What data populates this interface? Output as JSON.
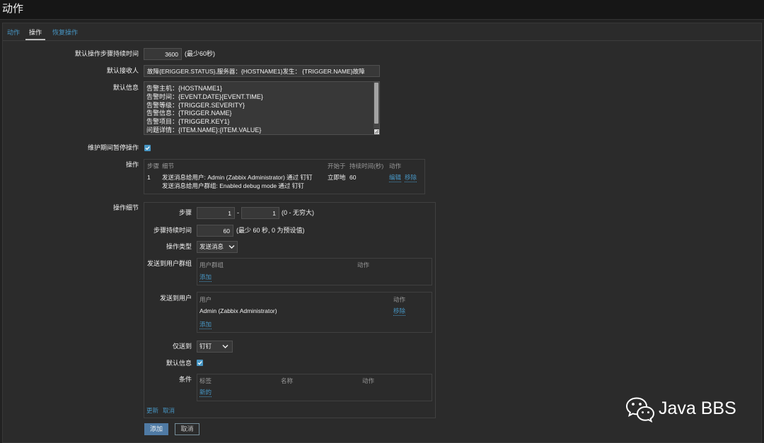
{
  "page": {
    "title": "动作"
  },
  "tabs": [
    {
      "label": "动作",
      "active": false
    },
    {
      "label": "操作",
      "active": true
    },
    {
      "label": "恢复操作",
      "active": false
    }
  ],
  "form": {
    "default_step_duration": {
      "label": "默认操作步骤持续时间",
      "value": "3600",
      "hint": "(最少60秒)"
    },
    "default_subject": {
      "label": "默认接收人",
      "value": "故障{ERIGGER.STATUS},服务器：{HOSTNAME1}发生： {TRIGGER.NAME}故障"
    },
    "default_message": {
      "label": "默认信息",
      "value": "告警主机：{HOSTNAME1}\n告警时间：{EVENT.DATE}{EVENT.TIME}\n告警等级：{TRIGGER.SEVERITY}\n告警信息：{TRIGGER.NAME}\n告警项目：{TRIGGER.KEY1}\n问题详情：{ITEM.NAME}:{ITEM.VALUE}"
    },
    "pause_in_maintenance": {
      "label": "维护期间暂停操作",
      "checked": true,
      "icon": "check-icon"
    },
    "operations": {
      "label": "操作",
      "columns": {
        "step": "步骤",
        "details": "细节",
        "start_in": "开始于",
        "duration": "持续时间(秒)",
        "action": "动作"
      },
      "rows": [
        {
          "step": "1",
          "details": [
            "发送消息给用户: Admin (Zabbix Administrator) 通过 钉钉",
            "发送消息给用户群组: Enabled debug mode 通过 钉钉"
          ],
          "start_in": "立即地",
          "duration": "60",
          "edit": "编辑",
          "remove": "移除"
        }
      ]
    },
    "operation_details": {
      "label": "操作细节",
      "steps": {
        "label": "步骤",
        "from": "1",
        "separator": "-",
        "to": "1",
        "hint": "(0 - 无穷大)"
      },
      "step_duration": {
        "label": "步骤持续时间",
        "value": "60",
        "hint": "(最少 60 秒, 0 为预设值)"
      },
      "operation_type": {
        "label": "操作类型",
        "value": "发送消息",
        "icon": "chevron-down-icon"
      },
      "send_to_user_groups": {
        "label": "发送到用户群组",
        "column_group": "用户群组",
        "column_action": "动作",
        "add": "添加"
      },
      "send_to_users": {
        "label": "发送到用户",
        "column_user": "用户",
        "column_action": "动作",
        "rows": [
          {
            "name": "Admin (Zabbix Administrator)",
            "remove": "移除"
          }
        ],
        "add": "添加"
      },
      "send_only_to": {
        "label": "仅送到",
        "value": "钉钉",
        "icon": "chevron-down-icon"
      },
      "default_message": {
        "label": "默认信息",
        "checked": true,
        "icon": "check-icon"
      },
      "conditions": {
        "label": "条件",
        "column_label": "标签",
        "column_name": "名称",
        "column_action": "动作",
        "new": "新的"
      },
      "update": "更新",
      "cancel": "取消"
    }
  },
  "buttons": {
    "add": "添加",
    "cancel": "取消"
  },
  "watermark": {
    "icon": "wechat-icon",
    "text": "Java BBS"
  },
  "theme": {
    "link": "#4796c4",
    "accent": "#4796c4",
    "primary_button": "#4f7aa4",
    "text": "#f2f2f2",
    "background": "#2b2b2b"
  }
}
